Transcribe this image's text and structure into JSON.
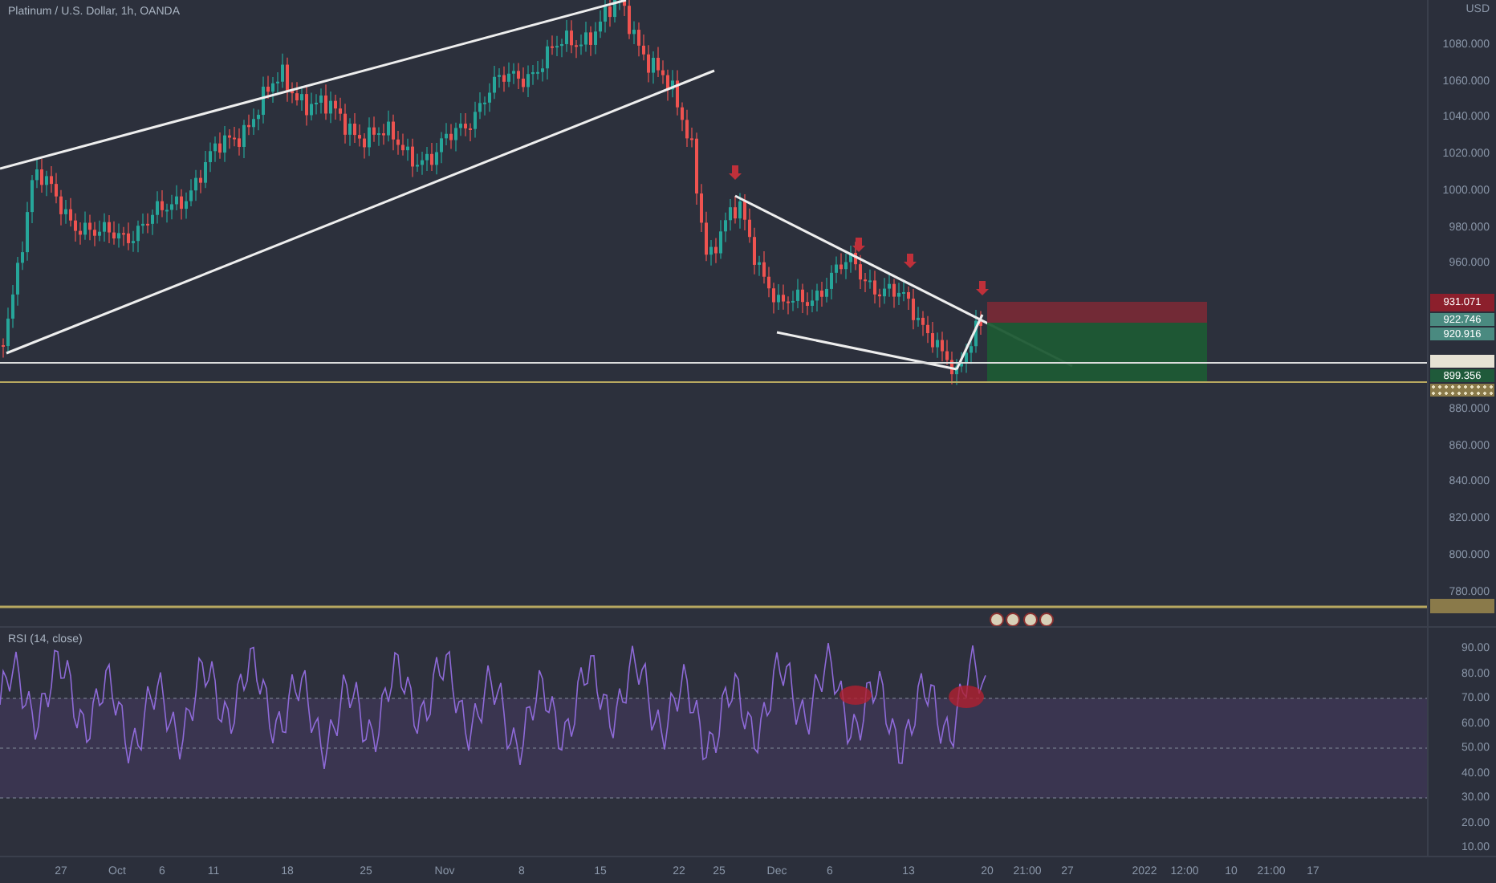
{
  "title": "Platinum / U.S. Dollar, 1h, OANDA",
  "price_axis": {
    "currency": "USD",
    "ticks": [
      "1080.000",
      "1060.000",
      "1040.000",
      "1020.000",
      "1000.000",
      "980.000",
      "960.000",
      "880.000",
      "860.000",
      "840.000",
      "820.000",
      "800.000",
      "780.000"
    ]
  },
  "price_tags": [
    {
      "kind": "stop",
      "text": "931.071",
      "color": "#8c1f2c"
    },
    {
      "kind": "price",
      "text": "922.746",
      "color": "#4a8a80"
    },
    {
      "kind": "price",
      "text": "920.916",
      "color": "#4a8a80"
    },
    {
      "kind": "line",
      "color": "#e6e2d4"
    },
    {
      "kind": "price",
      "text": "899.356",
      "color": "#1f5a3a"
    },
    {
      "kind": "alert",
      "color": "#8a7a4a"
    }
  ],
  "alert_tag": {
    "color": "#8a7a4a"
  },
  "rsi": {
    "label": "RSI (14, close)",
    "ticks": [
      "90.00",
      "80.00",
      "70.00",
      "60.00",
      "50.00",
      "40.00",
      "30.00",
      "20.00",
      "10.00"
    ]
  },
  "time_axis": [
    "27",
    "Oct",
    "6",
    "11",
    "18",
    "25",
    "Nov",
    "8",
    "15",
    "22",
    "25",
    "Dec",
    "6",
    "13",
    "20",
    "21:00",
    "27",
    "2022",
    "12:00",
    "10",
    "21:00",
    "17"
  ]
}
